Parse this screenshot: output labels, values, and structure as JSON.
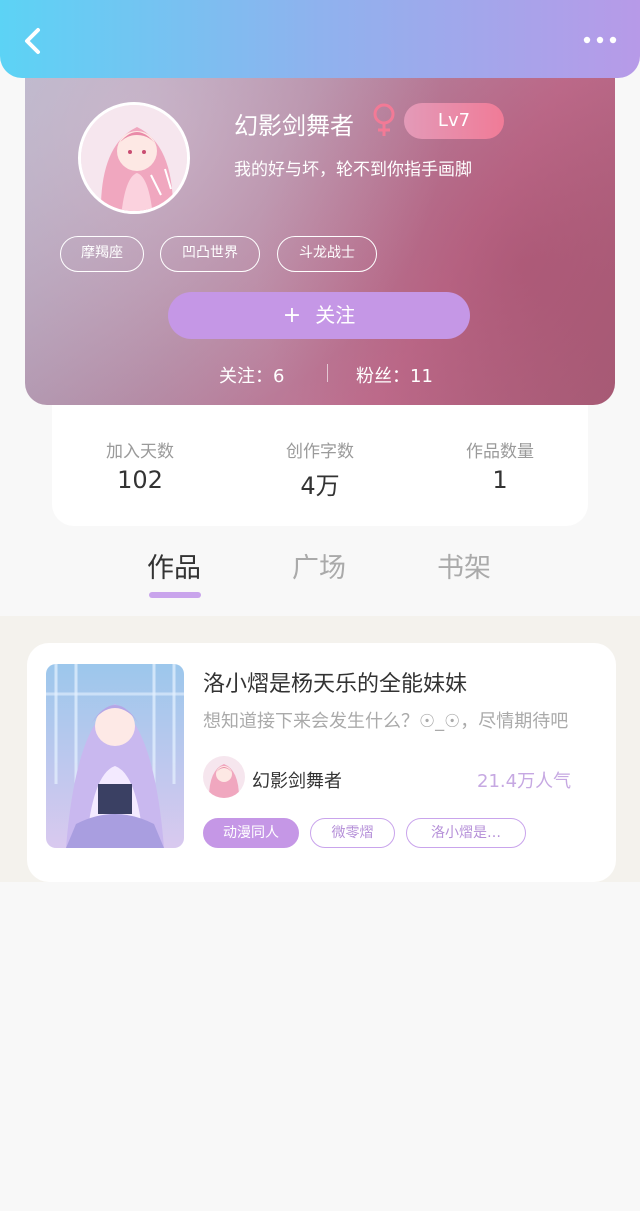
{
  "header": {
    "back_icon": "chevron-left-icon",
    "more_icon": "more-dots-icon",
    "gradient": [
      "#5cd3f5",
      "#b79ae8"
    ]
  },
  "profile": {
    "username": "幻影剑舞者",
    "gender_icon": "female-icon",
    "level": "Lv7",
    "bio": "我的好与坏，轮不到你指手画脚",
    "tags": [
      "摩羯座",
      "凹凸世界",
      "斗龙战士"
    ],
    "follow_button": "关注",
    "following_label": "关注：6",
    "followers_label": "粉丝：11"
  },
  "stats": [
    {
      "label": "加入天数",
      "value": "102"
    },
    {
      "label": "创作字数",
      "value": "4万"
    },
    {
      "label": "作品数量",
      "value": "1"
    }
  ],
  "tabs": [
    {
      "label": "作品",
      "active": true
    },
    {
      "label": "广场",
      "active": false
    },
    {
      "label": "书架",
      "active": false
    }
  ],
  "works": [
    {
      "title": "洛小熠是杨天乐的全能妹妹",
      "description": "想知道接下来会发生什么？☉_☉，尽情期待吧",
      "author": "幻影剑舞者",
      "popularity": "21.4万人气",
      "tags": [
        "动漫同人",
        "微零熠",
        "洛小熠是…"
      ]
    }
  ],
  "colors": {
    "accent": "#c597e6",
    "level_badge": "#f07b97",
    "popularity": "#c6a8e2"
  }
}
